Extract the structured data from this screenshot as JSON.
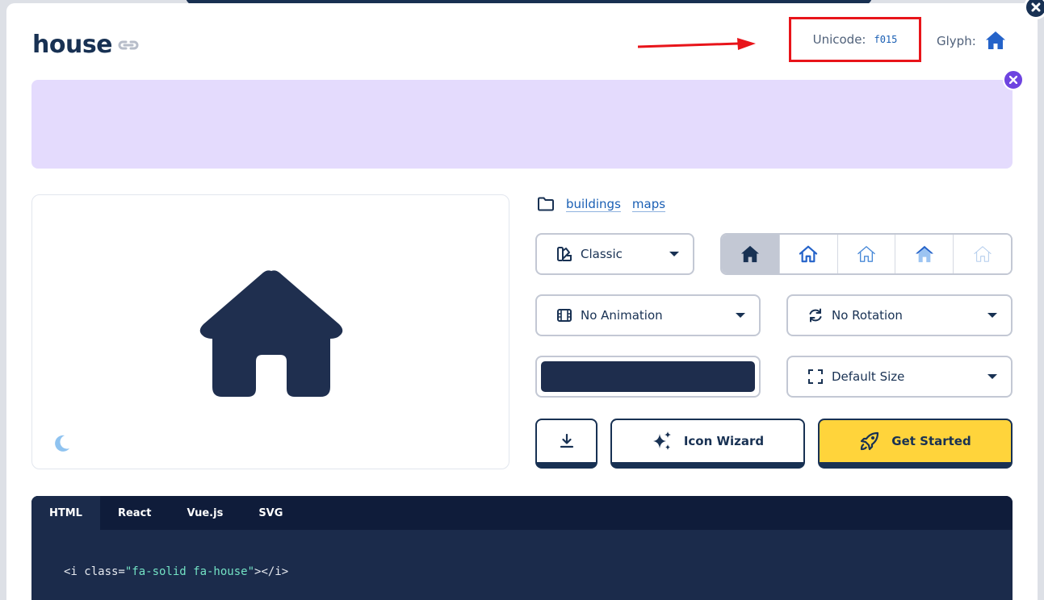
{
  "modal": {
    "title": "house",
    "unicode_label": "Unicode:",
    "unicode_value": "f015",
    "glyph_label": "Glyph:"
  },
  "categories": [
    "buildings",
    "maps"
  ],
  "controls": {
    "family": "Classic",
    "animation": "No Animation",
    "rotation": "No Rotation",
    "size": "Default Size",
    "color": "#1e2d4d"
  },
  "actions": {
    "wizard_label": "Icon Wizard",
    "get_started_label": "Get Started"
  },
  "code_tabs": [
    "HTML",
    "React",
    "Vue.js",
    "SVG"
  ],
  "code": {
    "open": "<i class=",
    "value": "\"fa-solid fa-house\"",
    "close": "></i>"
  },
  "colors": {
    "brand_navy": "#183153",
    "promo_bg": "#e4dbfd",
    "cta_yellow": "#ffd43b",
    "highlight_red": "#e8141a"
  }
}
